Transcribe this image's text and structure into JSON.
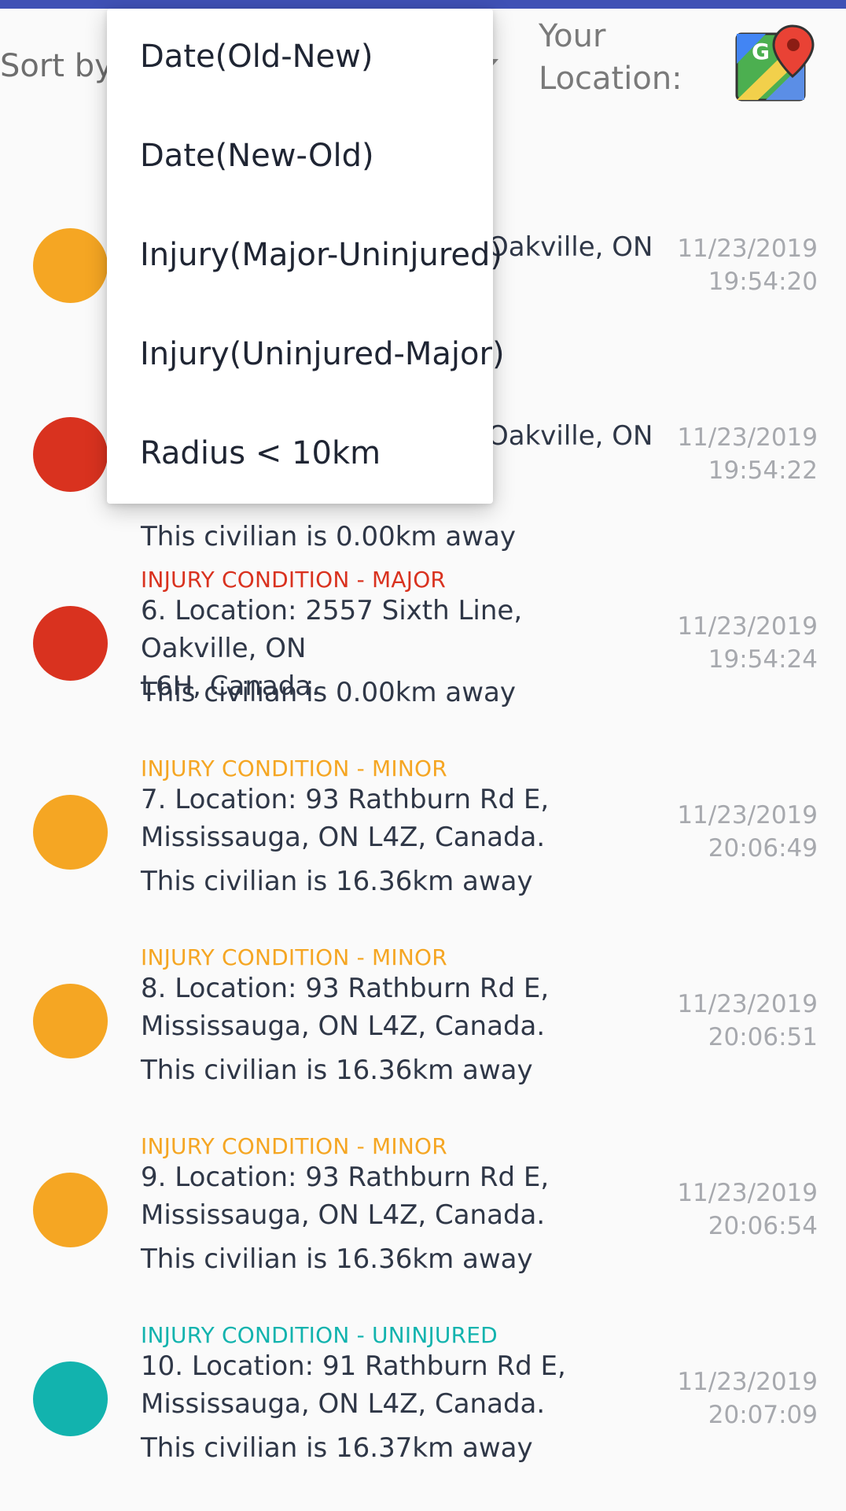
{
  "header": {
    "sort_label": "Sort by:",
    "location_label": "Your Location:",
    "maps_icon": "google-maps-icon"
  },
  "dropdown": {
    "options": [
      "Date(Old-New)",
      "Date(New-Old)",
      "Injury(Major-Uninjured)",
      "Injury(Uninjured-Major)",
      "Radius < 10km"
    ]
  },
  "colors": {
    "topbar": "#3f51b5",
    "minor": "#f5a623",
    "major": "#d9321f",
    "uninjured": "#12b3ae"
  },
  "items": [
    {
      "condition": "",
      "location_line1": "Oakville, ON",
      "location_line2": "",
      "distance": "",
      "date": "11/23/2019",
      "time": "19:54:20",
      "severity": "minor"
    },
    {
      "condition": "",
      "location_line1": "Oakville, ON",
      "location_line2": "",
      "distance": "This civilian is 0.00km away",
      "date": "11/23/2019",
      "time": "19:54:22",
      "severity": "major"
    },
    {
      "condition": "INJURY CONDITION - MAJOR",
      "location_line1": "6. Location: 2557 Sixth Line, Oakville, ON",
      "location_line2": "L6H, Canada.",
      "distance": "This civilian is 0.00km away",
      "date": "11/23/2019",
      "time": "19:54:24",
      "severity": "major"
    },
    {
      "condition": "INJURY CONDITION - MINOR",
      "location_line1": "7. Location: 93 Rathburn Rd E,",
      "location_line2": "Mississauga, ON L4Z, Canada.",
      "distance": "This civilian is 16.36km away",
      "date": "11/23/2019",
      "time": "20:06:49",
      "severity": "minor"
    },
    {
      "condition": "INJURY CONDITION - MINOR",
      "location_line1": "8. Location: 93 Rathburn Rd E,",
      "location_line2": "Mississauga, ON L4Z, Canada.",
      "distance": "This civilian is 16.36km away",
      "date": "11/23/2019",
      "time": "20:06:51",
      "severity": "minor"
    },
    {
      "condition": "INJURY CONDITION - MINOR",
      "location_line1": "9. Location: 93 Rathburn Rd E,",
      "location_line2": "Mississauga, ON L4Z, Canada.",
      "distance": "This civilian is 16.36km away",
      "date": "11/23/2019",
      "time": "20:06:54",
      "severity": "minor"
    },
    {
      "condition": "INJURY CONDITION - UNINJURED",
      "location_line1": "10. Location: 91 Rathburn Rd E,",
      "location_line2": "Mississauga, ON L4Z, Canada.",
      "distance": "This civilian is 16.37km away",
      "date": "11/23/2019",
      "time": "20:07:09",
      "severity": "uninjured"
    }
  ]
}
